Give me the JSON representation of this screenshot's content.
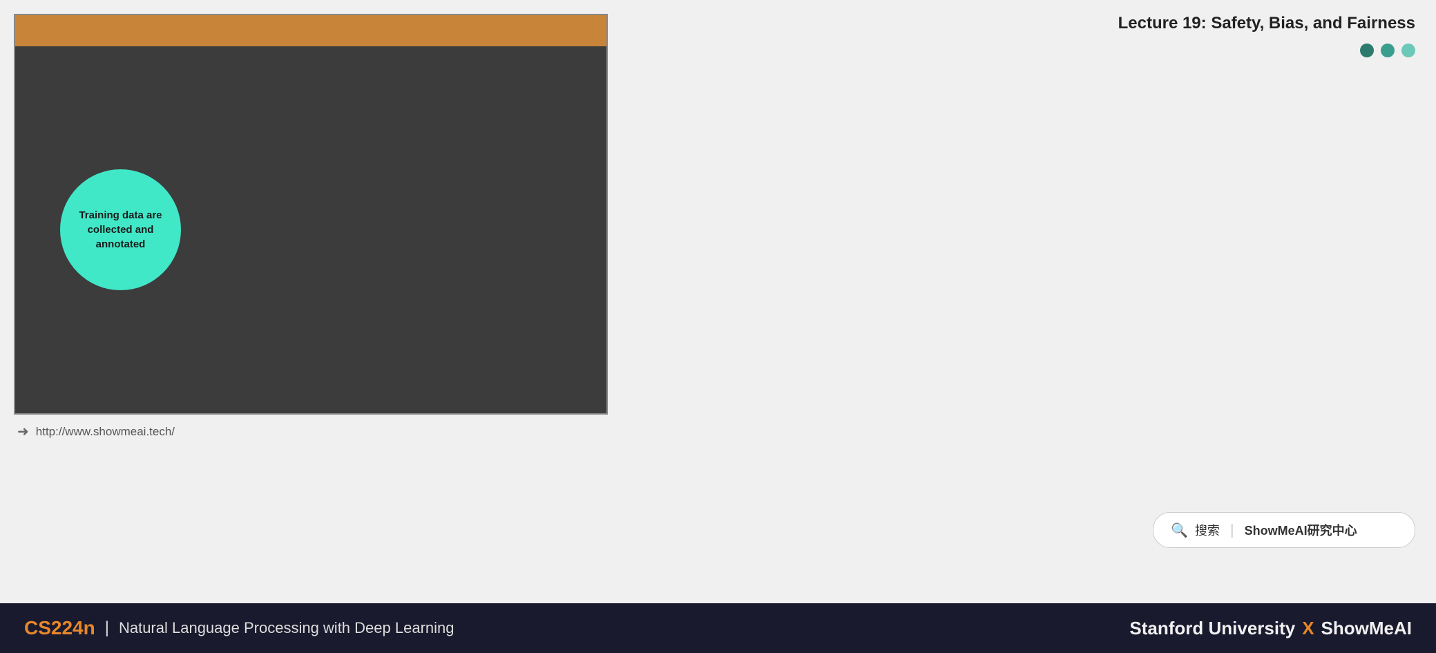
{
  "header": {
    "lecture_title": "Lecture 19: Safety, Bias, and Fairness"
  },
  "dots": [
    {
      "color_class": "dot-dark-teal",
      "label": "dot-1"
    },
    {
      "color_class": "dot-teal",
      "label": "dot-2"
    },
    {
      "color_class": "dot-light-teal",
      "label": "dot-3"
    }
  ],
  "slide": {
    "bubble_text": "Training data are collected and annotated"
  },
  "url_bar": {
    "url": "http://www.showmeai.tech/"
  },
  "search": {
    "icon": "🔍",
    "separator": "|",
    "label_normal": "搜索",
    "label_bold": "ShowMeAI研究中心"
  },
  "bottom_bar": {
    "course_code": "CS224n",
    "separator": "|",
    "course_name": "Natural Language Processing with Deep Learning",
    "university": "Stanford University",
    "x": "X",
    "brand": "ShowMeAI"
  }
}
